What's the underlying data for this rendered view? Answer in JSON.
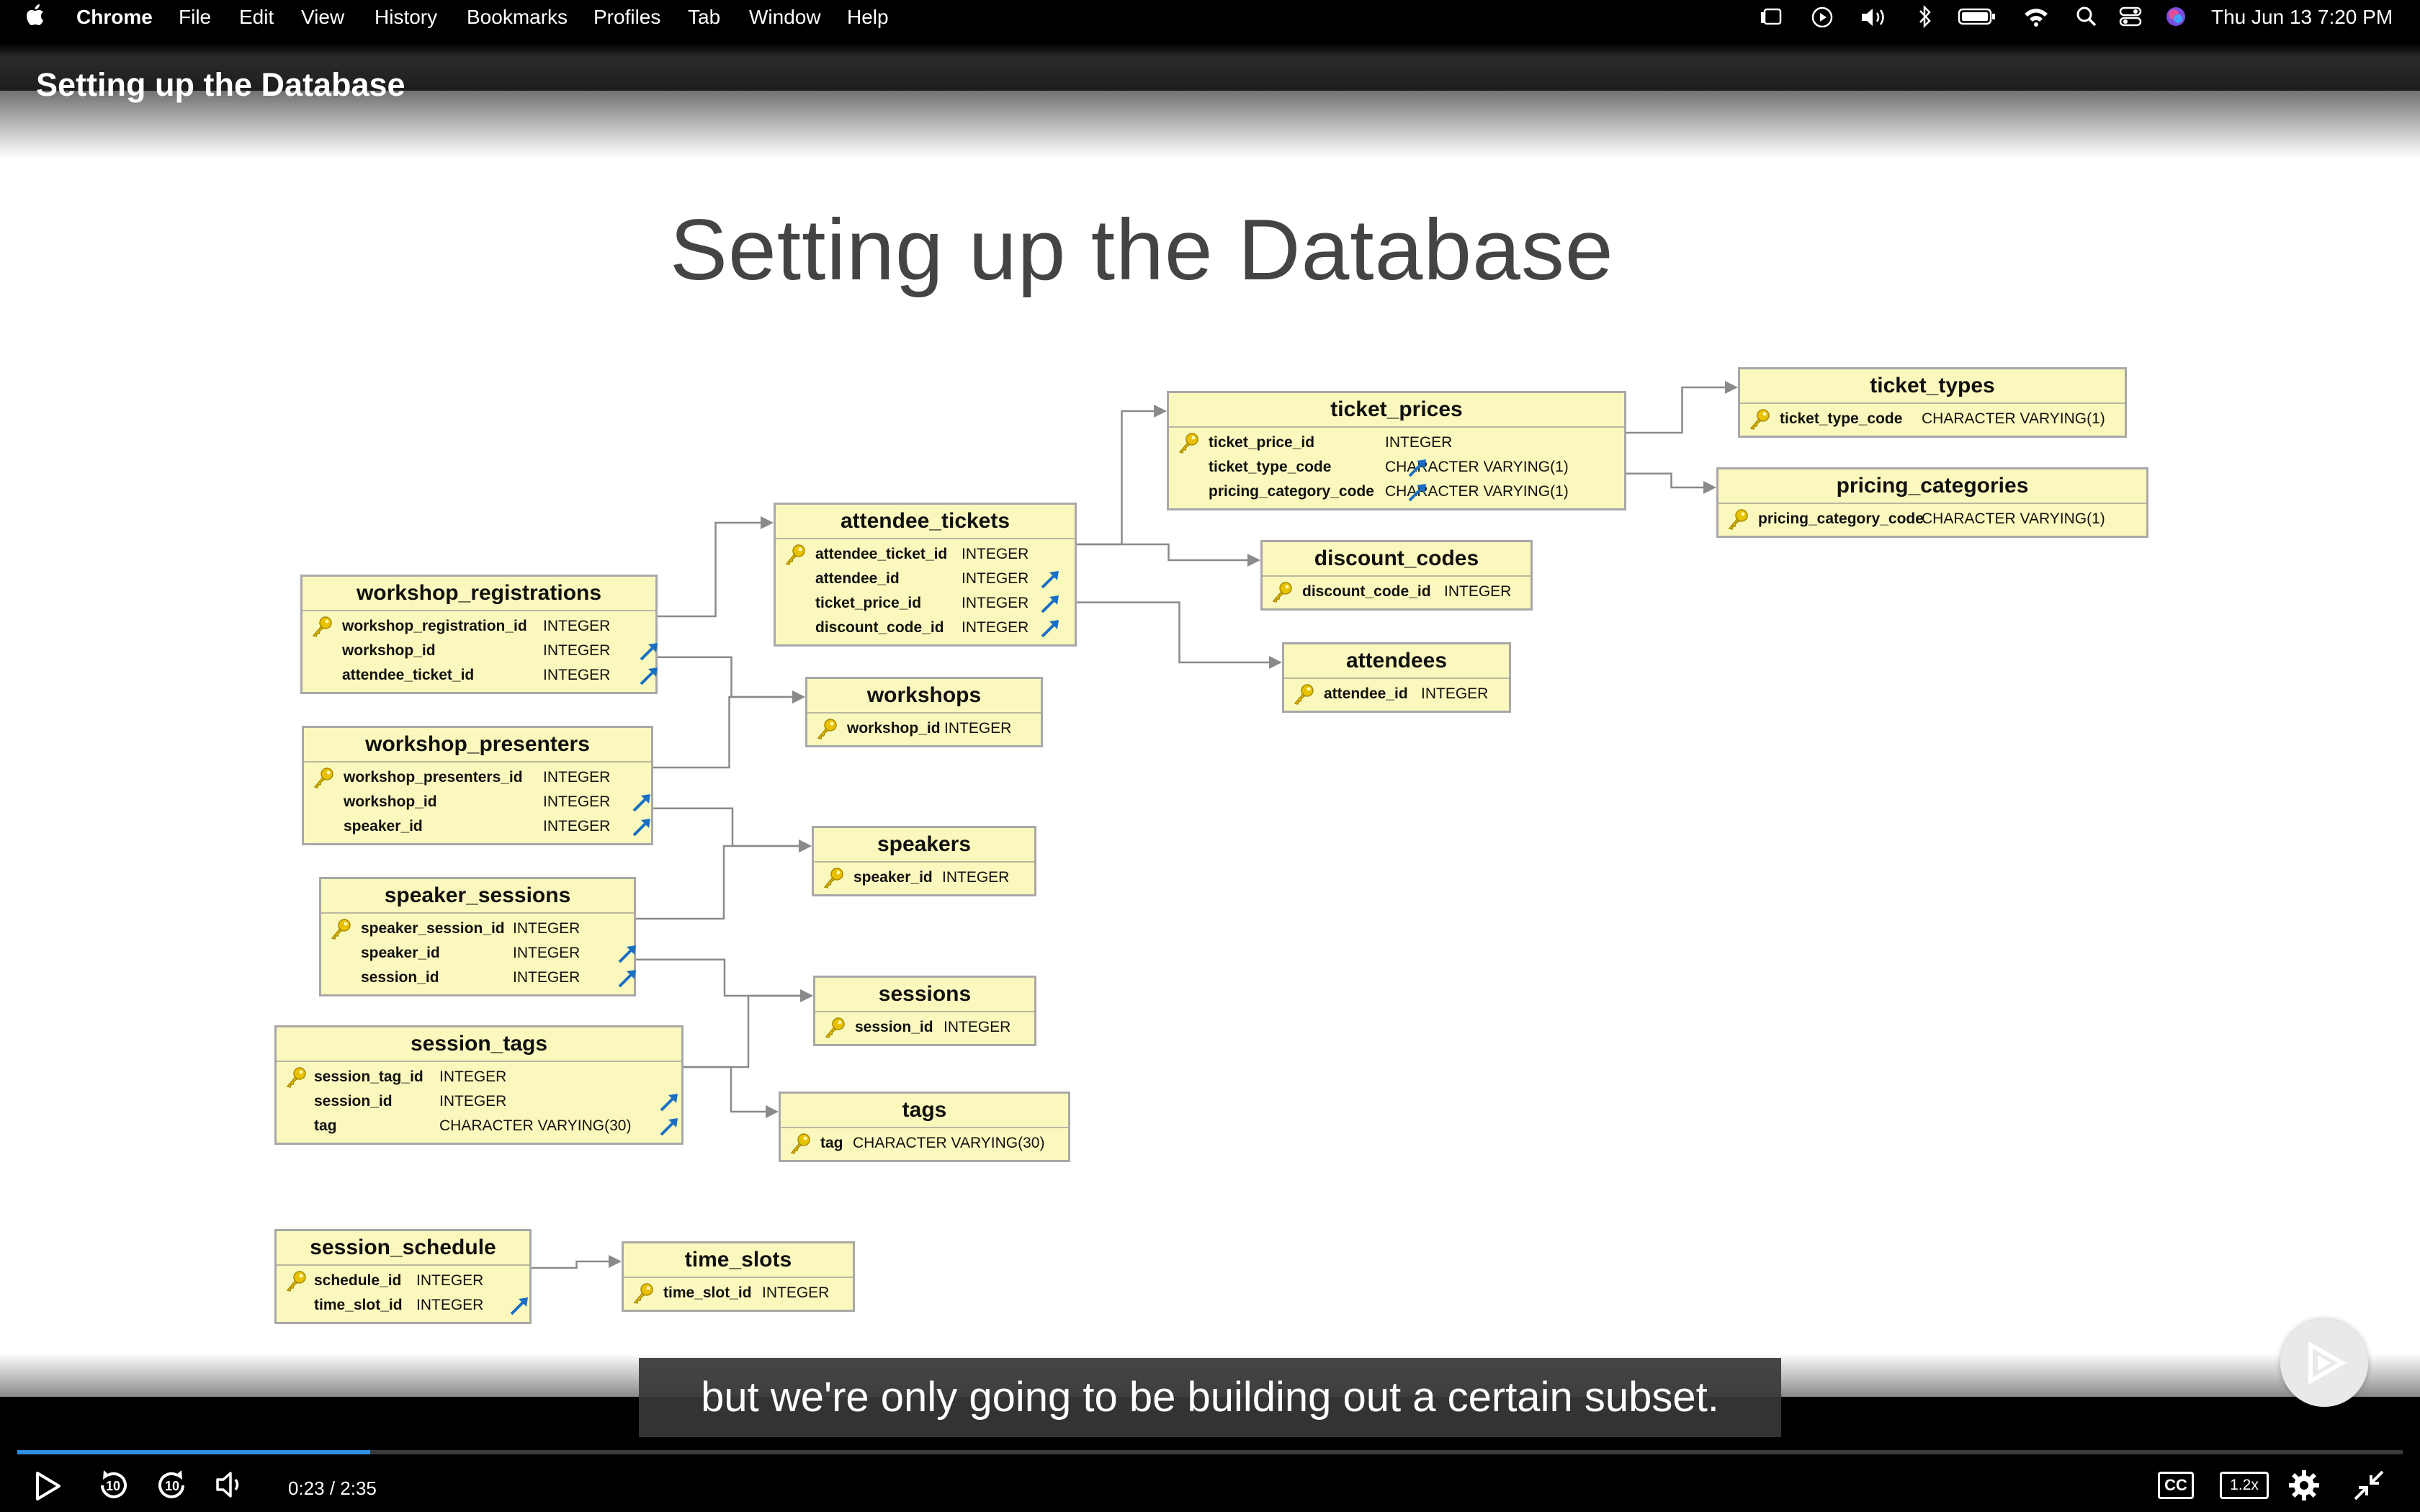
{
  "menubar": {
    "app": "Chrome",
    "menus": [
      "File",
      "Edit",
      "View",
      "History",
      "Bookmarks",
      "Profiles",
      "Tab",
      "Window",
      "Help"
    ],
    "clock": "Thu Jun 13  7:20 PM"
  },
  "video": {
    "title": "Setting up the Database",
    "slide_title": "Setting up the Database",
    "caption": "but we're only going to be building out a certain subset.",
    "time": "0:23 / 2:35",
    "progress": 0.148,
    "speed": "1.2x",
    "cc": "CC",
    "skip_seconds": "10"
  },
  "tables": [
    {
      "id": "ticket_prices",
      "name": "ticket_prices",
      "columns": [
        {
          "name": "ticket_price_id",
          "type": "INTEGER",
          "pk": true,
          "fk": false
        },
        {
          "name": "ticket_type_code",
          "type": "CHARACTER VARYING(1)",
          "pk": false,
          "fk": true
        },
        {
          "name": "pricing_category_code",
          "type": "CHARACTER VARYING(1)",
          "pk": false,
          "fk": true
        }
      ]
    },
    {
      "id": "ticket_types",
      "name": "ticket_types",
      "columns": [
        {
          "name": "ticket_type_code",
          "type": "CHARACTER VARYING(1)",
          "pk": true,
          "fk": false
        }
      ]
    },
    {
      "id": "pricing_categories",
      "name": "pricing_categories",
      "columns": [
        {
          "name": "pricing_category_code",
          "type": "CHARACTER VARYING(1)",
          "pk": true,
          "fk": false
        }
      ]
    },
    {
      "id": "attendee_tickets",
      "name": "attendee_tickets",
      "columns": [
        {
          "name": "attendee_ticket_id",
          "type": "INTEGER",
          "pk": true,
          "fk": false
        },
        {
          "name": "attendee_id",
          "type": "INTEGER",
          "pk": false,
          "fk": true
        },
        {
          "name": "ticket_price_id",
          "type": "INTEGER",
          "pk": false,
          "fk": true
        },
        {
          "name": "discount_code_id",
          "type": "INTEGER",
          "pk": false,
          "fk": true
        }
      ]
    },
    {
      "id": "discount_codes",
      "name": "discount_codes",
      "columns": [
        {
          "name": "discount_code_id",
          "type": "INTEGER",
          "pk": true,
          "fk": false
        }
      ]
    },
    {
      "id": "attendees",
      "name": "attendees",
      "columns": [
        {
          "name": "attendee_id",
          "type": "INTEGER",
          "pk": true,
          "fk": false
        }
      ]
    },
    {
      "id": "workshop_registrations",
      "name": "workshop_registrations",
      "columns": [
        {
          "name": "workshop_registration_id",
          "type": "INTEGER",
          "pk": true,
          "fk": false
        },
        {
          "name": "workshop_id",
          "type": "INTEGER",
          "pk": false,
          "fk": true
        },
        {
          "name": "attendee_ticket_id",
          "type": "INTEGER",
          "pk": false,
          "fk": true
        }
      ]
    },
    {
      "id": "workshops",
      "name": "workshops",
      "columns": [
        {
          "name": "workshop_id",
          "type": "INTEGER",
          "pk": true,
          "fk": false
        }
      ]
    },
    {
      "id": "workshop_presenters",
      "name": "workshop_presenters",
      "columns": [
        {
          "name": "workshop_presenters_id",
          "type": "INTEGER",
          "pk": true,
          "fk": false
        },
        {
          "name": "workshop_id",
          "type": "INTEGER",
          "pk": false,
          "fk": true
        },
        {
          "name": "speaker_id",
          "type": "INTEGER",
          "pk": false,
          "fk": true
        }
      ]
    },
    {
      "id": "speakers",
      "name": "speakers",
      "columns": [
        {
          "name": "speaker_id",
          "type": "INTEGER",
          "pk": true,
          "fk": false
        }
      ]
    },
    {
      "id": "speaker_sessions",
      "name": "speaker_sessions",
      "columns": [
        {
          "name": "speaker_session_id",
          "type": "INTEGER",
          "pk": true,
          "fk": false
        },
        {
          "name": "speaker_id",
          "type": "INTEGER",
          "pk": false,
          "fk": true
        },
        {
          "name": "session_id",
          "type": "INTEGER",
          "pk": false,
          "fk": true
        }
      ]
    },
    {
      "id": "sessions",
      "name": "sessions",
      "columns": [
        {
          "name": "session_id",
          "type": "INTEGER",
          "pk": true,
          "fk": false
        }
      ]
    },
    {
      "id": "session_tags",
      "name": "session_tags",
      "columns": [
        {
          "name": "session_tag_id",
          "type": "INTEGER",
          "pk": true,
          "fk": false
        },
        {
          "name": "session_id",
          "type": "INTEGER",
          "pk": false,
          "fk": true
        },
        {
          "name": "tag",
          "type": "CHARACTER VARYING(30)",
          "pk": false,
          "fk": true
        }
      ]
    },
    {
      "id": "tags",
      "name": "tags",
      "columns": [
        {
          "name": "tag",
          "type": "CHARACTER VARYING(30)",
          "pk": true,
          "fk": false
        }
      ]
    },
    {
      "id": "session_schedule",
      "name": "session_schedule",
      "columns": [
        {
          "name": "schedule_id",
          "type": "INTEGER",
          "pk": true,
          "fk": false
        },
        {
          "name": "time_slot_id",
          "type": "INTEGER",
          "pk": false,
          "fk": true
        }
      ]
    },
    {
      "id": "time_slots",
      "name": "time_slots",
      "columns": [
        {
          "name": "time_slot_id",
          "type": "INTEGER",
          "pk": true,
          "fk": false
        }
      ]
    }
  ],
  "relations": [
    {
      "from": "attendee_tickets",
      "to": "ticket_prices"
    },
    {
      "from": "ticket_prices",
      "to": "ticket_types"
    },
    {
      "from": "ticket_prices",
      "to": "pricing_categories"
    },
    {
      "from": "attendee_tickets",
      "to": "discount_codes"
    },
    {
      "from": "attendee_tickets",
      "to": "attendees"
    },
    {
      "from": "workshop_registrations",
      "to": "attendee_tickets"
    },
    {
      "from": "workshop_registrations",
      "to": "workshops"
    },
    {
      "from": "workshop_presenters",
      "to": "workshops"
    },
    {
      "from": "workshop_presenters",
      "to": "speakers"
    },
    {
      "from": "speaker_sessions",
      "to": "speakers"
    },
    {
      "from": "speaker_sessions",
      "to": "sessions"
    },
    {
      "from": "session_tags",
      "to": "sessions"
    },
    {
      "from": "session_tags",
      "to": "tags"
    },
    {
      "from": "session_schedule",
      "to": "time_slots"
    }
  ],
  "colors": {
    "table_fill": "#fbf8bd",
    "key": "#e8c200",
    "fk_arrow": "#1a6fc4",
    "progress": "#2f8fe0"
  }
}
